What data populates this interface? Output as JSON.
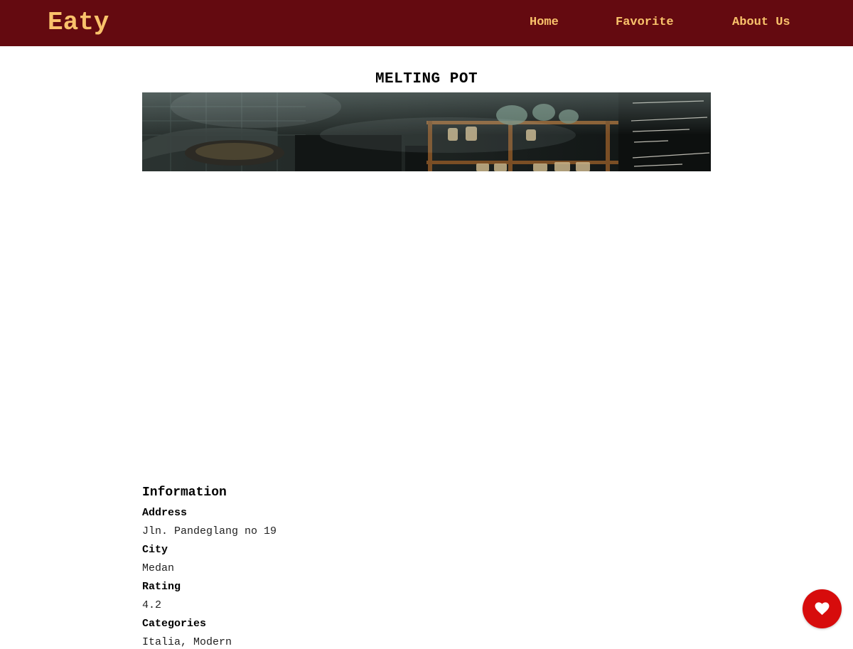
{
  "header": {
    "brand": "Eaty",
    "nav": {
      "home": "Home",
      "favorite": "Favorite",
      "about": "About Us"
    }
  },
  "restaurant": {
    "name": "MELTING POT",
    "hero_image": "restaurant-photo"
  },
  "information": {
    "heading": "Information",
    "address_label": "Address",
    "address": "Jln. Pandeglang no 19",
    "city_label": "City",
    "city": "Medan",
    "rating_label": "Rating",
    "rating": "4.2",
    "categories_label": "Categories",
    "categories_partial": "Italia, Modern"
  },
  "favorite_button": {
    "icon": "heart-icon"
  },
  "colors": {
    "app_bar": "#640a10",
    "brand_accent": "#f9c26b",
    "fab": "#d70c0c"
  }
}
